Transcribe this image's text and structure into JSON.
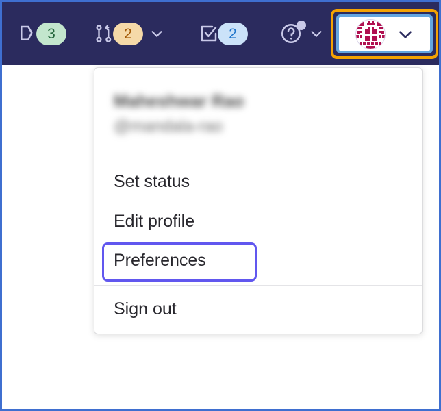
{
  "navbar": {
    "background_color": "#2b2b5e",
    "items": [
      {
        "name": "merge-requests-reviews",
        "icon": "merge-request-review-icon",
        "badge_count": "3",
        "badge_color": "#c3e6cd",
        "badge_text_color": "#24663b",
        "has_chevron": false
      },
      {
        "name": "merge-requests",
        "icon": "merge-request-icon",
        "badge_count": "2",
        "badge_color": "#f5d9a8",
        "badge_text_color": "#a35a06",
        "has_chevron": true
      },
      {
        "name": "todos",
        "icon": "todo-checkbox-icon",
        "badge_count": "2",
        "badge_color": "#cbe2f9",
        "badge_text_color": "#1f75cb",
        "has_chevron": false
      },
      {
        "name": "help",
        "icon": "question-circle-icon",
        "badge_count": "",
        "has_notification_dot": true,
        "has_chevron": true
      }
    ],
    "avatar": {
      "name": "user-avatar",
      "alt": "user identicon avatar",
      "identicon_color": "#b01050",
      "highlight_outer_color": "#f5a302",
      "focus_ring_color": "#63a6e0",
      "has_chevron": true
    }
  },
  "dropdown": {
    "name": "user-menu",
    "user": {
      "fullname": "Maheshwar Rao",
      "handle": "@mandala-rao",
      "blurred": true
    },
    "sections": [
      {
        "items": [
          {
            "id": "set-status",
            "label": "Set status",
            "highlighted": false
          },
          {
            "id": "edit-profile",
            "label": "Edit profile",
            "highlighted": false
          },
          {
            "id": "preferences",
            "label": "Preferences",
            "highlighted": true,
            "highlight_color": "#6157ef"
          }
        ]
      },
      {
        "items": [
          {
            "id": "sign-out",
            "label": "Sign out",
            "highlighted": false
          }
        ]
      }
    ]
  },
  "frame": {
    "border_color": "#3f6fd0",
    "background_color": "#ffffff"
  }
}
